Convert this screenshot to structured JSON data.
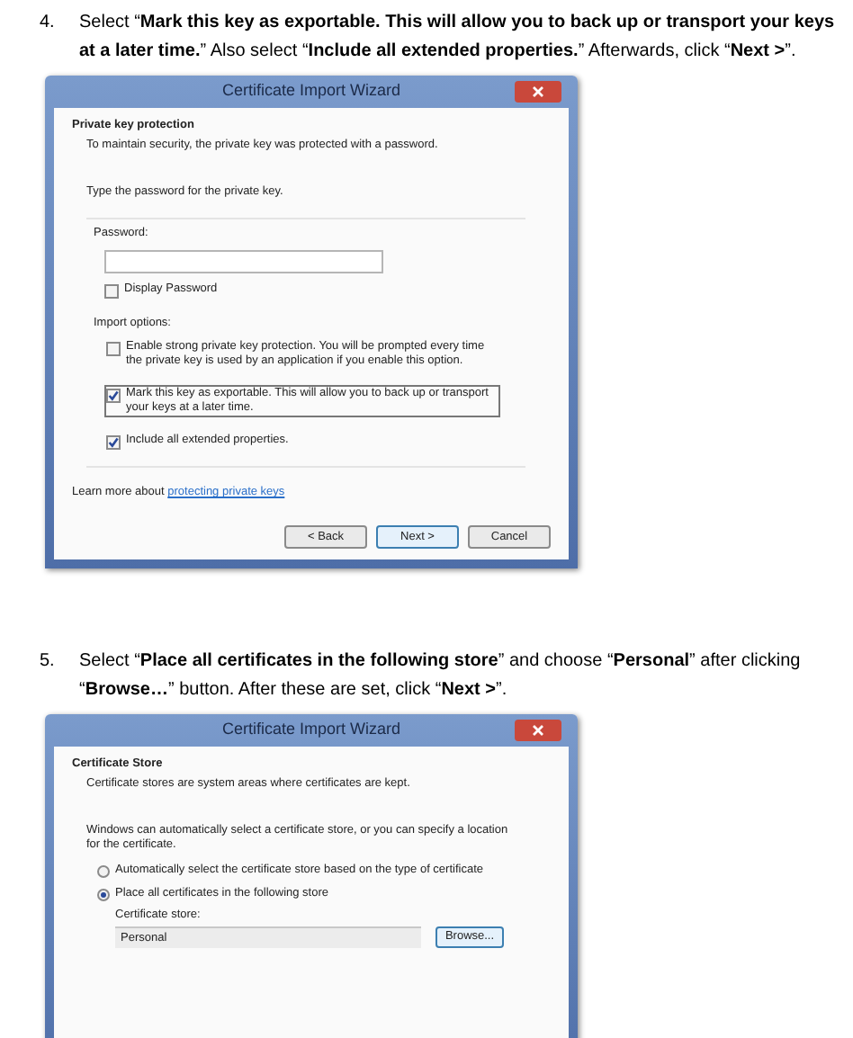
{
  "steps": [
    {
      "number": "4.",
      "instruction": "Select “**Mark this key as exportable. This will allow you to back up or transport your keys at a later time.**” Also select “**Include all extended properties.**” Afterwards, click “**Next >**”.",
      "dialog": {
        "kind": "private_key",
        "title": "Certificate Import Wizard",
        "heading": "Private key protection",
        "subheading": "To maintain security, the private key was protected with a password.",
        "prompt": "Type the password for the private key.",
        "password_label": "Password:",
        "display_password": {
          "label": "Display Password",
          "checked": false
        },
        "options_label": "Import options:",
        "options": [
          {
            "label": "Enable strong private key protection. You will be prompted every time the private key is used by an application if you enable this option.",
            "checked": false,
            "focused": false
          },
          {
            "label": "Mark this key as exportable. This will allow you to back up or transport your keys at a later time.",
            "checked": true,
            "focused": true
          },
          {
            "label": "Include all extended properties.",
            "checked": true,
            "focused": false
          }
        ],
        "learn_more": {
          "text": "Learn more about",
          "link": "protecting private keys"
        },
        "buttons": [
          {
            "label": "< Back",
            "default": false
          },
          {
            "label": "Next >",
            "default": true
          },
          {
            "label": "Cancel",
            "default": false
          }
        ]
      }
    },
    {
      "number": "5.",
      "instruction": "Select “**Place all certificates in the following store**” and choose “**Personal**” after clicking “**Browse…**” button. After these are set, click “**Next >**”.",
      "dialog": {
        "kind": "store",
        "title": "Certificate Import Wizard",
        "heading": "Certificate Store",
        "subheading": "Certificate stores are system areas where certificates are kept.",
        "description": "Windows can automatically select a certificate store, or you can specify a location for the certificate.",
        "radios": [
          {
            "label": "Automatically select the certificate store based on the type of certificate",
            "selected": false
          },
          {
            "label": "Place all certificates in the following store",
            "selected": true
          }
        ],
        "store_label": "Certificate store:",
        "store_value": "Personal",
        "browse_button": "Browse..."
      }
    }
  ]
}
